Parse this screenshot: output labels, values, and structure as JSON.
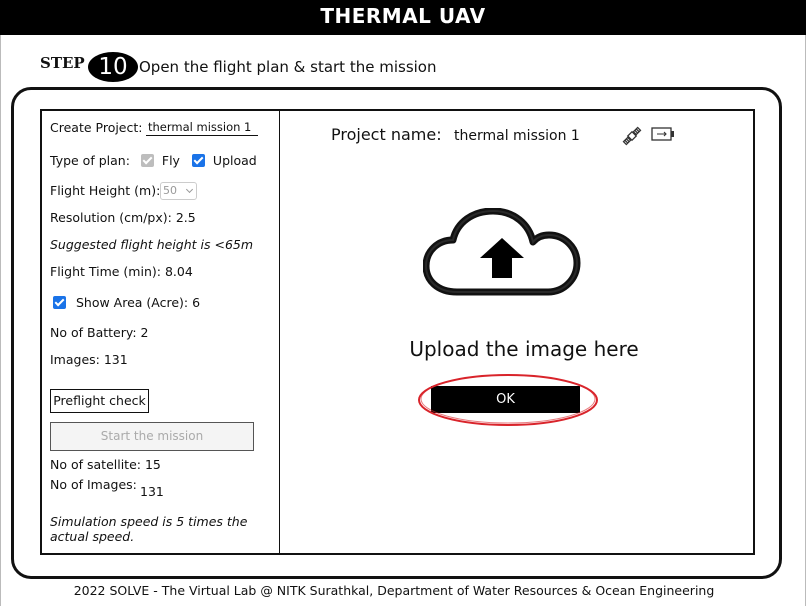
{
  "header": {
    "title": "THERMAL UAV"
  },
  "step": {
    "label": "STEP",
    "number": "10",
    "instruction": "Open the flight plan & start the mission"
  },
  "left_panel": {
    "create_project_label": "Create Project:",
    "create_project_value": "thermal mission 1",
    "type_of_plan_label": "Type of plan:",
    "fly_label": "Fly",
    "fly_checked": true,
    "fly_disabled": true,
    "upload_label": "Upload",
    "upload_checked": true,
    "flight_height_label": "Flight Height (m):",
    "flight_height_value": "50",
    "resolution": "Resolution (cm/px): 2.5",
    "suggested": "Suggested flight height is <65m",
    "flight_time": "Flight Time (min): 8.04",
    "show_area_label": "Show Area (Acre): 6",
    "show_area_checked": true,
    "battery": "No of Battery: 2",
    "images": "Images: 131",
    "preflight_label": "Preflight check",
    "start_label": "Start the mission",
    "satellite": "No of satellite: 15",
    "images_count_label": "No of Images:",
    "images_count_value": "131",
    "simulation_note_line1": "Simulation speed is 5 times the",
    "simulation_note_line2": "actual speed."
  },
  "right_panel": {
    "project_name_label": "Project name:",
    "project_name_value": "thermal mission 1",
    "icons": [
      "satellite-icon",
      "battery-icon",
      "cloud-upload-icon"
    ],
    "upload_prompt": "Upload the image here",
    "ok_label": "OK",
    "highlight_color": "#d9242b"
  },
  "footer": {
    "text": "2022 SOLVE - The Virtual Lab @ NITK Surathkal, Department of Water Resources & Ocean Engineering"
  }
}
